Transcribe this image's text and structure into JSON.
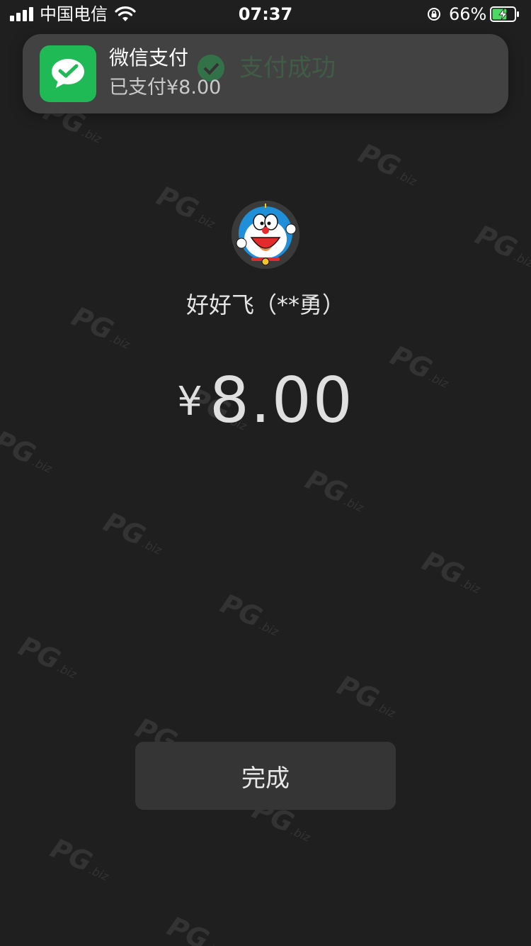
{
  "status_bar": {
    "carrier": "中国电信",
    "time": "07:37",
    "battery_percent": "66%",
    "battery_level": 0.66,
    "battery_charging": true,
    "icons": [
      "signal-icon",
      "wifi-icon",
      "orientation-lock-icon",
      "battery-icon"
    ]
  },
  "notification": {
    "app_name": "微信支付",
    "body": "已支付¥8.00",
    "background_text": "支付成功",
    "app_icon": "wechat-icon",
    "accent_color": "#1fb955"
  },
  "payment": {
    "payee": "好好飞（**勇）",
    "currency_symbol": "¥",
    "amount": "8.00",
    "avatar_icon": "doraemon-avatar"
  },
  "actions": {
    "done_label": "完成"
  },
  "watermark": {
    "text": "PG",
    "suffix": ".biz"
  },
  "colors": {
    "background": "#1f1f1f",
    "button": "#353535",
    "notification": "#444444",
    "wechat_green": "#1fb955"
  }
}
